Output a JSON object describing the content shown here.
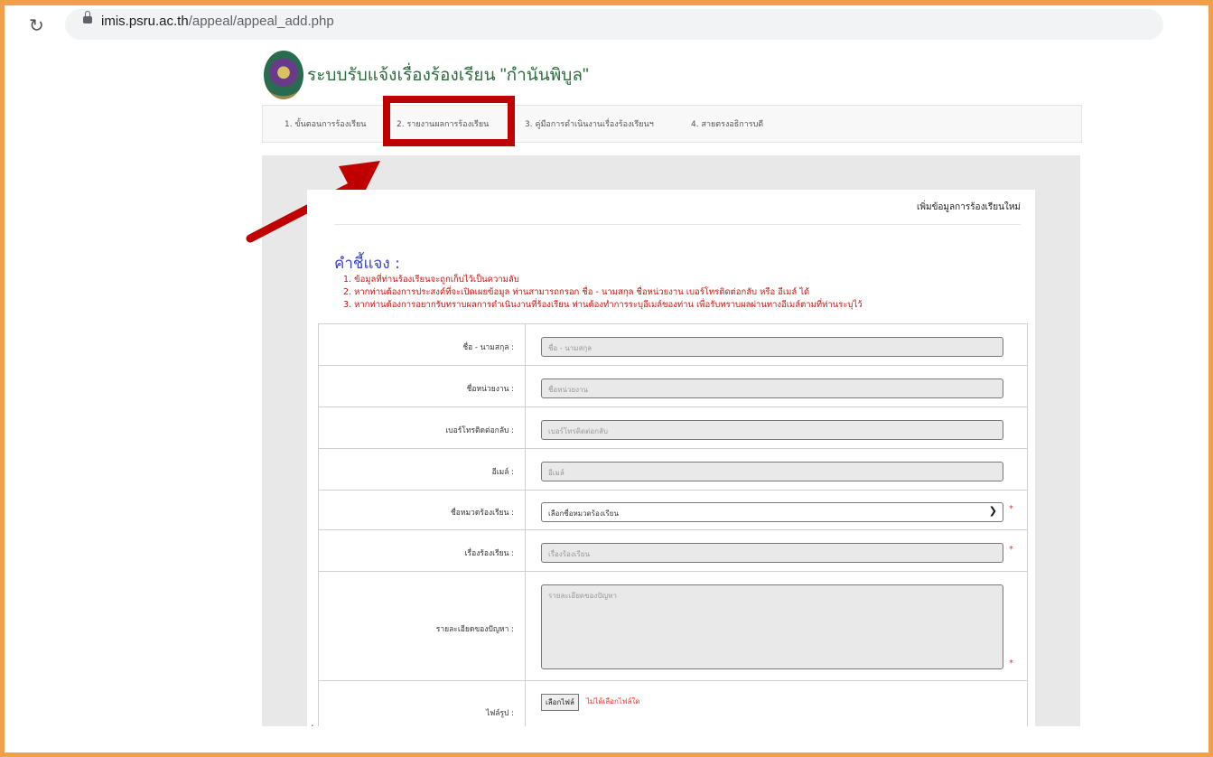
{
  "browser": {
    "url_host": "imis.psru.ac.th",
    "url_path": "/appeal/appeal_add.php"
  },
  "site": {
    "title": "ระบบรับแจ้งเรื่องร้องเรียน \"กำนันพิบูล\""
  },
  "nav": {
    "tabs": [
      "1. ขั้นตอนการร้องเรียน",
      "2. รายงานผลการร้องเรียน",
      "3. คู่มือการดำเนินงานเรื่องร้องเรียนฯ",
      "4. สายตรงอธิการบดี"
    ],
    "highlighted_index": 1
  },
  "card": {
    "title": "เพิ่มข้อมูลการร้องเรียนใหม่",
    "notice_heading": "คำชี้แจง :",
    "notices": [
      "1. ข้อมูลที่ท่านร้องเรียนจะถูกเก็บไว้เป็นความลับ",
      "2. หากท่านต้องการประสงค์ที่จะเปิดเผยข้อมูล ท่านสามารถกรอก ชื่อ - นามสกุล ชื่อหน่วยงาน เบอร์โทรติดต่อกลับ หรือ อีเมล์ ได้",
      "3. หากท่านต้องการอยากรับทราบผลการดำเนินงานที่ร้องเรียน ท่านต้องทำการระบุอีเมล์ของท่าน เพื่อรับทราบผลผ่านทางอีเมล์ตามที่ท่านระบุไว้"
    ]
  },
  "form": {
    "rows": [
      {
        "label": "ชื่อ - นามสกุล :",
        "placeholder": "ชื่อ - นามสกุล",
        "required": false
      },
      {
        "label": "ชื่อหน่วยงาน :",
        "placeholder": "ชื่อหน่วยงาน",
        "required": false
      },
      {
        "label": "เบอร์โทรติดต่อกลับ :",
        "placeholder": "เบอร์โทรติดต่อกลับ",
        "required": false
      },
      {
        "label": "อีเมล์ :",
        "placeholder": "อีเมล์",
        "required": false
      },
      {
        "label": "ชื่อหมวดร้องเรียน :",
        "value": "เลือกชื่อหมวดร้องเรียน",
        "required": true
      },
      {
        "label": "เรื่องร้องเรียน :",
        "placeholder": "เรื่องร้องเรียน",
        "required": true
      },
      {
        "label": "รายละเอียดของปัญหา :",
        "placeholder": "รายละเอียดของปัญหา",
        "required": true
      },
      {
        "label": "ไฟล์รูป :",
        "button": "เลือกไฟล์",
        "status": "ไม่ได้เลือกไฟล์ใด"
      }
    ],
    "required_mark": "*"
  },
  "footer_fragment": "ป"
}
